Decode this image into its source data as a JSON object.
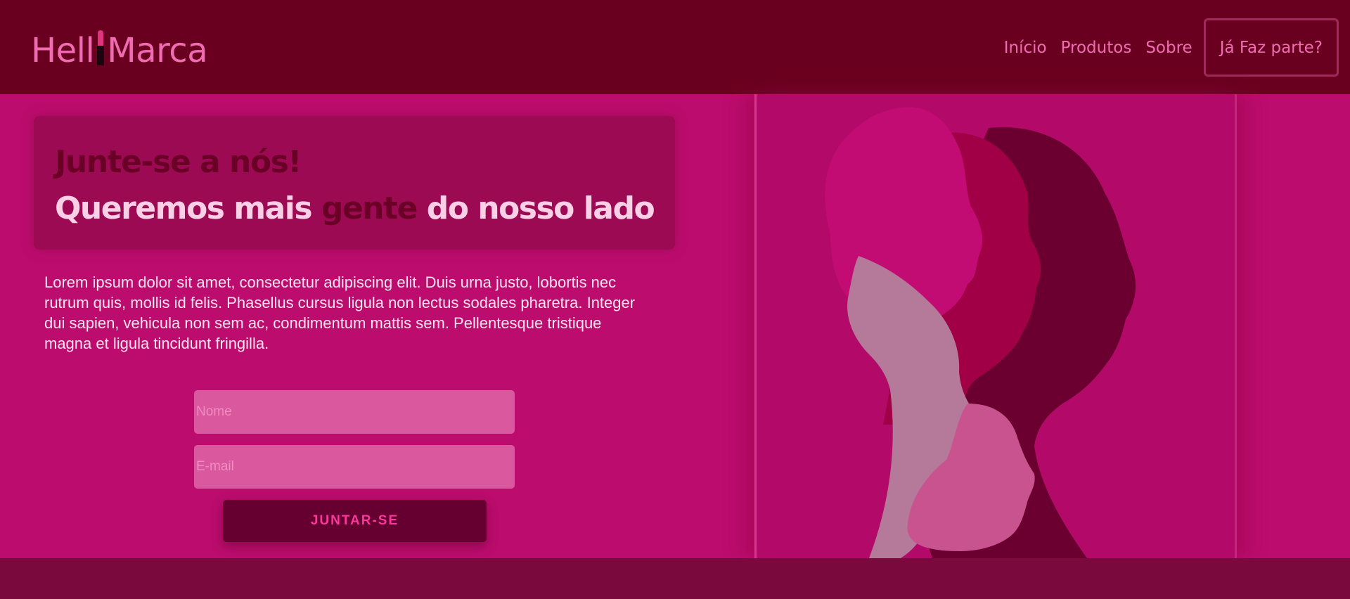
{
  "brand": {
    "name_part1": "Hell",
    "name_part2": "Marca"
  },
  "nav": {
    "items": [
      "Início",
      "Produtos",
      "Sobre"
    ],
    "cta": "Já Faz parte?"
  },
  "hero": {
    "title": "Junte-se a nós!",
    "subtitle_before": "Queremos mais ",
    "subtitle_highlight": "gente",
    "subtitle_after": " do nosso lado"
  },
  "description": "Lorem ipsum dolor sit amet, consectetur adipiscing elit. Duis urna justo, lobortis nec rutrum quis, mollis id felis. Phasellus cursus ligula non lectus sodales pharetra. Integer dui sapien, vehicula non sem ac, condimentum mattis sem. Pellentesque tristique magna et ligula tincidunt fringilla.",
  "form": {
    "name_placeholder": "Nome",
    "email_placeholder": "E-mail",
    "submit_label": "JUNTAR-SE"
  },
  "icons": {
    "logo_mark": "lipstick-icon",
    "illustration": "women-silhouettes-illustration"
  },
  "colors": {
    "header_bg": "#6a0020",
    "page_bg": "#bc0c6e",
    "accent_pink": "#f06cb2",
    "dark_maroon": "#650030",
    "footer_bg": "#7a0a3e"
  }
}
